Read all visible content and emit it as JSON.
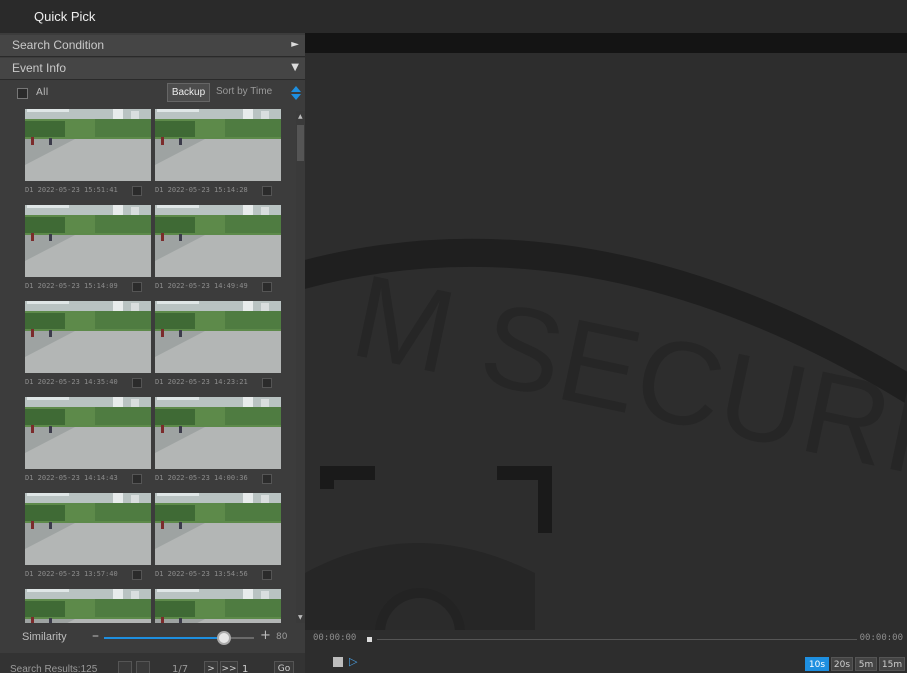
{
  "window": {
    "title": "Quick Pick"
  },
  "sidebar": {
    "search_condition_label": "Search Condition",
    "event_info_label": "Event Info",
    "select_all_label": "All",
    "backup_label": "Backup",
    "sort_label": "Sort by Time"
  },
  "events": [
    {
      "caption": "D1 2022-05-23 15:51:41"
    },
    {
      "caption": "D1 2022-05-23 15:14:28"
    },
    {
      "caption": "D1 2022-05-23 15:14:09"
    },
    {
      "caption": "D1 2022-05-23 14:49:49"
    },
    {
      "caption": "D1 2022-05-23 14:35:40"
    },
    {
      "caption": "D1 2022-05-23 14:23:21"
    },
    {
      "caption": "D1 2022-05-23 14:14:43"
    },
    {
      "caption": "D1 2022-05-23 14:00:36"
    },
    {
      "caption": "D1 2022-05-23 13:57:40"
    },
    {
      "caption": "D1 2022-05-23 13:54:56"
    },
    {
      "caption": ""
    },
    {
      "caption": ""
    }
  ],
  "similarity": {
    "label": "Similarity",
    "value": "80",
    "level": 0.8
  },
  "results": {
    "label": "Search Results:125",
    "page": "1/7",
    "next_label": ">",
    "last_label": ">>",
    "page_input": "1",
    "go_label": "Go"
  },
  "player": {
    "time_start": "00:00:00",
    "time_end": "00:00:00",
    "speeds": [
      "10s",
      "20s",
      "5m",
      "15m"
    ],
    "active_speed": "10s"
  },
  "watermark": {
    "text": "M SECURIT"
  },
  "colors": {
    "accent": "#1e8fe0",
    "panel": "#3c3c3c",
    "viewer": "#2d2d2d"
  }
}
